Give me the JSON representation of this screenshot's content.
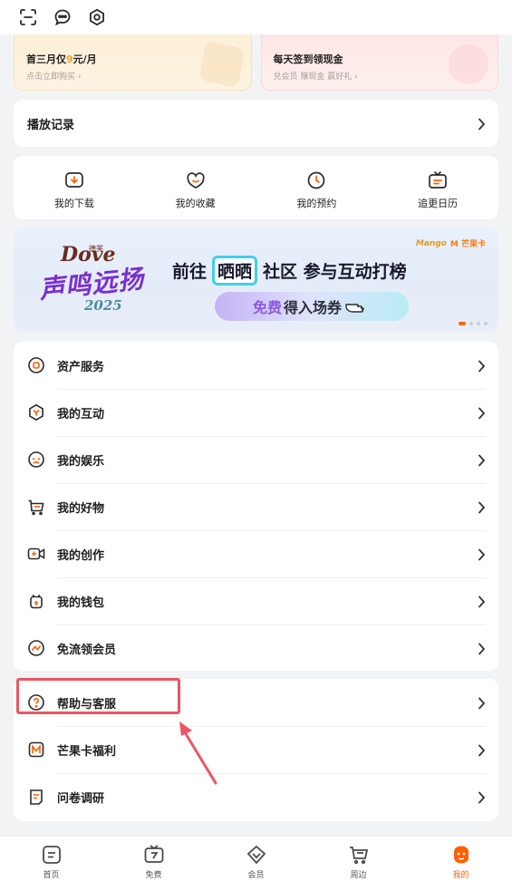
{
  "top_icons": [
    "scan-icon",
    "message-icon",
    "settings-icon"
  ],
  "promos": {
    "left": {
      "title_pre": "首三月仅",
      "title_hl": "9",
      "title_post": "元/月",
      "subtitle": "点击立即购买 ›"
    },
    "right": {
      "title": "每天签到领现金",
      "subtitle": "兑会员 赚现金 赢好礼 ›"
    }
  },
  "history": {
    "label": "播放记录"
  },
  "quick_actions": [
    {
      "label": "我的下载",
      "icon": "download-icon"
    },
    {
      "label": "我的收藏",
      "icon": "favorite-icon"
    },
    {
      "label": "我的预约",
      "icon": "reservation-clock-icon"
    },
    {
      "label": "追更日历",
      "icon": "calendar-tv-icon"
    }
  ],
  "banner": {
    "brand": "Dove",
    "brand_tag": "德芙",
    "script": "声鸣远扬",
    "year": "2025",
    "headline_pre": "前往",
    "headline_boxed": "晒晒",
    "headline_post": "社区 参与互动打榜",
    "pill_free": "免费",
    "pill_rest": "得入场券",
    "logo1": "Mango",
    "logo2": "M 芒果卡",
    "active_dot": 1,
    "dot_count": 4
  },
  "menu_primary": [
    {
      "label": "资产服务",
      "icon": "asset-icon"
    },
    {
      "label": "我的互动",
      "icon": "interaction-icon"
    },
    {
      "label": "我的娱乐",
      "icon": "entertainment-icon"
    },
    {
      "label": "我的好物",
      "icon": "goods-cart-icon"
    },
    {
      "label": "我的创作",
      "icon": "creation-camera-icon"
    },
    {
      "label": "我的钱包",
      "icon": "wallet-icon"
    },
    {
      "label": "免流领会员",
      "icon": "free-data-icon"
    }
  ],
  "menu_secondary": [
    {
      "label": "帮助与客服",
      "icon": "help-question-icon"
    },
    {
      "label": "芒果卡福利",
      "icon": "mango-card-icon"
    },
    {
      "label": "问卷调研",
      "icon": "survey-icon"
    }
  ],
  "tabs": [
    {
      "label": "首页",
      "icon": "home-tab-icon"
    },
    {
      "label": "免费",
      "icon": "free-tv-icon"
    },
    {
      "label": "会员",
      "icon": "vip-diamond-icon"
    },
    {
      "label": "周边",
      "icon": "shop-cart-icon"
    },
    {
      "label": "我的",
      "icon": "profile-mascot-icon",
      "active": true
    }
  ],
  "colors": {
    "accent": "#ff5f00",
    "highlight_box": "#ec5563",
    "icon_stroke": "#2b2b2b"
  }
}
